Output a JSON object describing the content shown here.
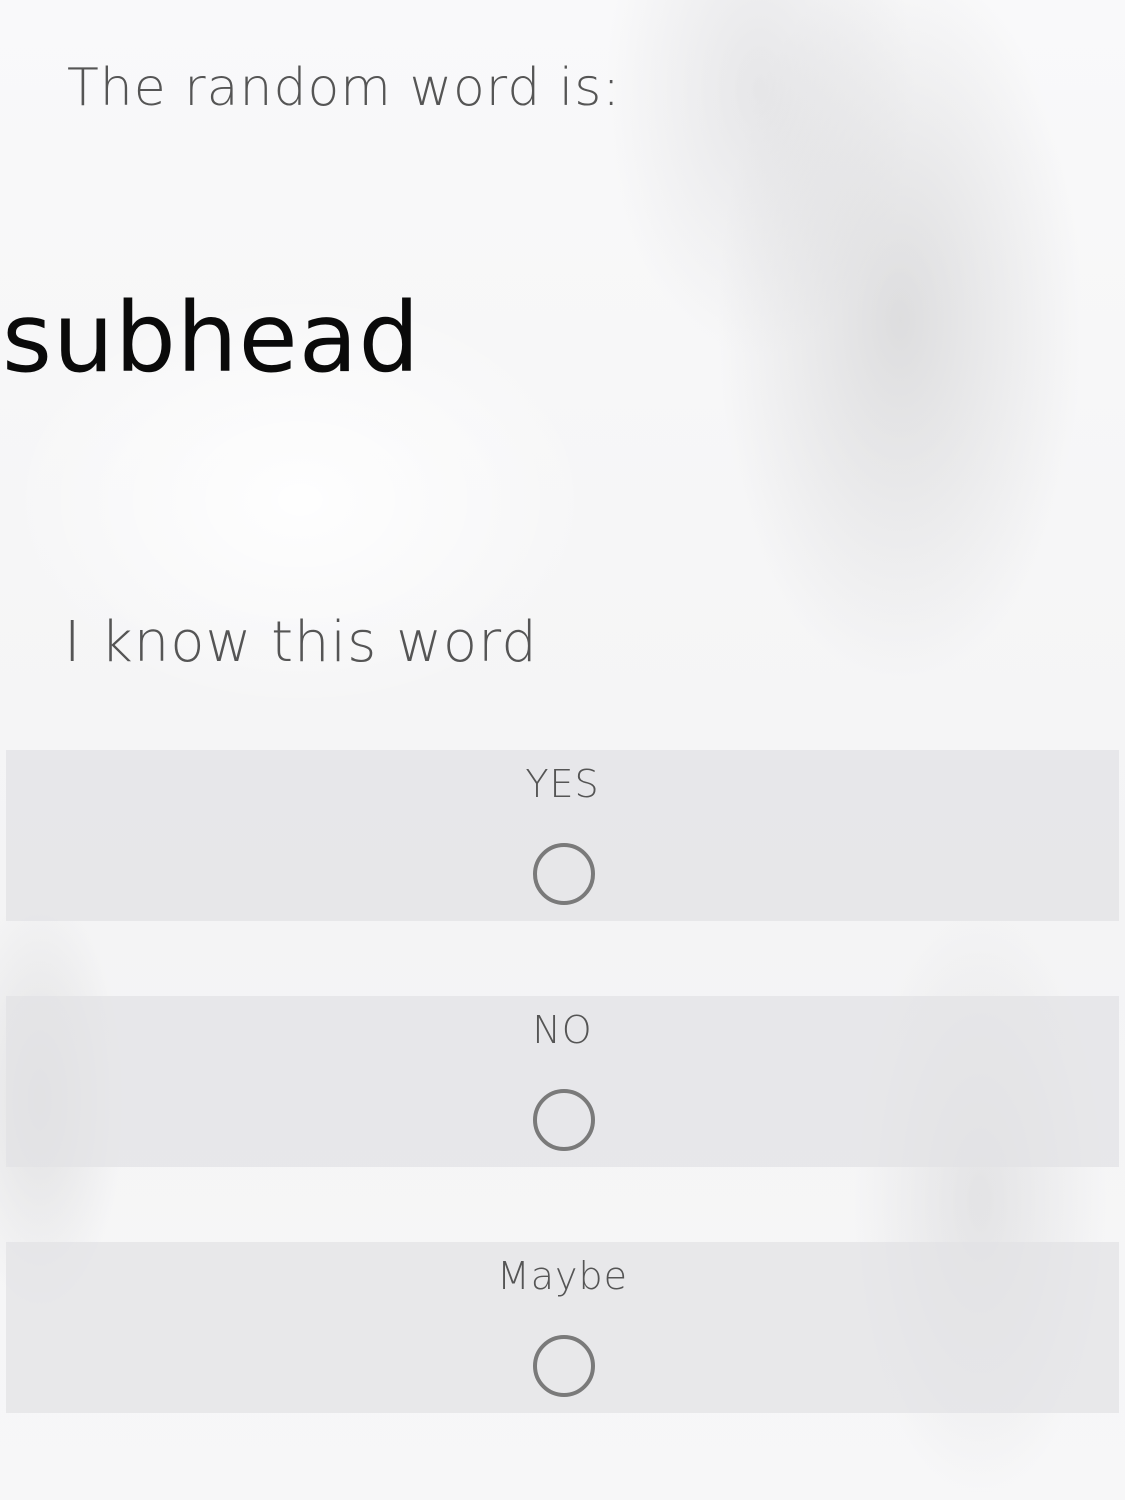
{
  "prompt": "The random word is:",
  "word": "subhead",
  "question": "I know this word",
  "options": [
    {
      "label": "YES",
      "selected": false
    },
    {
      "label": "NO",
      "selected": false
    },
    {
      "label": "Maybe",
      "selected": false
    }
  ]
}
